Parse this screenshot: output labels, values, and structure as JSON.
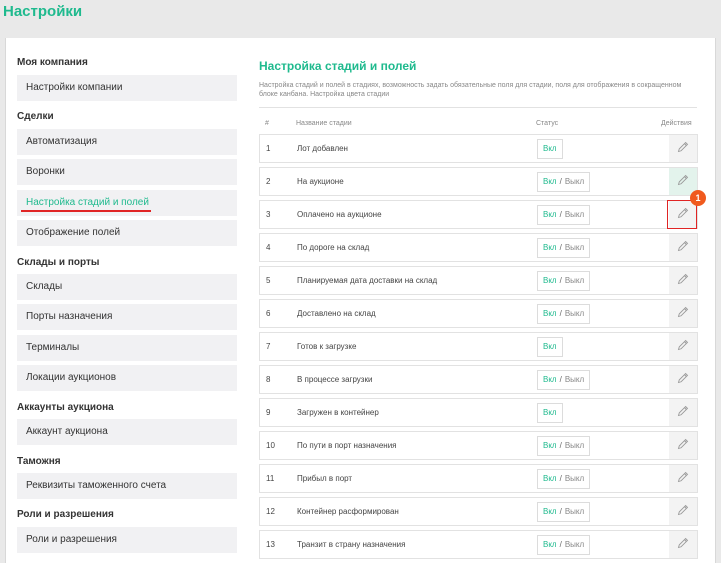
{
  "page": {
    "title": "Настройки"
  },
  "sidebar": {
    "groups": [
      {
        "title": "Моя компания",
        "items": [
          "Настройки компании"
        ]
      },
      {
        "title": "Сделки",
        "items": [
          "Автоматизация",
          "Воронки",
          "Настройка стадий и полей",
          "Отображение полей"
        ]
      },
      {
        "title": "Склады и порты",
        "items": [
          "Склады",
          "Порты назначения",
          "Терминалы",
          "Локации аукционов"
        ]
      },
      {
        "title": "Аккаунты аукциона",
        "items": [
          "Аккаунт аукциона"
        ]
      },
      {
        "title": "Таможня",
        "items": [
          "Реквизиты таможенного счета"
        ]
      },
      {
        "title": "Роли и разрешения",
        "items": [
          "Роли и разрешения"
        ]
      }
    ],
    "active_item": "Настройка стадий и полей"
  },
  "main": {
    "title": "Настройка стадий и полей",
    "description": "Настройка стадий и полей в стадиях, возможность задать обязательные поля для стадии, поля для отображения в сокращенном блоке канбана. Настройка цвета стадии",
    "columns": {
      "num": "#",
      "name": "Название стадии",
      "status": "Статус",
      "actions": "Действия"
    },
    "status_labels": {
      "on": "Вкл",
      "sep": "/",
      "off": "Выкл"
    },
    "rows": [
      {
        "num": "1",
        "name": "Лот добавлен",
        "toggle": false
      },
      {
        "num": "2",
        "name": "На аукционе",
        "toggle": true
      },
      {
        "num": "3",
        "name": "Оплачено на аукционе",
        "toggle": true
      },
      {
        "num": "4",
        "name": "По дороге на склад",
        "toggle": true
      },
      {
        "num": "5",
        "name": "Планируемая дата доставки на склад",
        "toggle": true
      },
      {
        "num": "6",
        "name": "Доставлено на склад",
        "toggle": true
      },
      {
        "num": "7",
        "name": "Готов к загрузке",
        "toggle": false
      },
      {
        "num": "8",
        "name": "В процессе загрузки",
        "toggle": true
      },
      {
        "num": "9",
        "name": "Загружен в контейнер",
        "toggle": false
      },
      {
        "num": "10",
        "name": "По пути в порт назначения",
        "toggle": true
      },
      {
        "num": "11",
        "name": "Прибыл в порт",
        "toggle": true
      },
      {
        "num": "12",
        "name": "Контейнер расформирован",
        "toggle": true
      },
      {
        "num": "13",
        "name": "Транзит в страну назначения",
        "toggle": true
      }
    ]
  },
  "annotation": {
    "marker": "1"
  },
  "icons": {
    "edit": "pencil-icon"
  },
  "colors": {
    "accent": "#1fba8e",
    "highlight": "#e02424",
    "marker": "#f05a1e"
  }
}
